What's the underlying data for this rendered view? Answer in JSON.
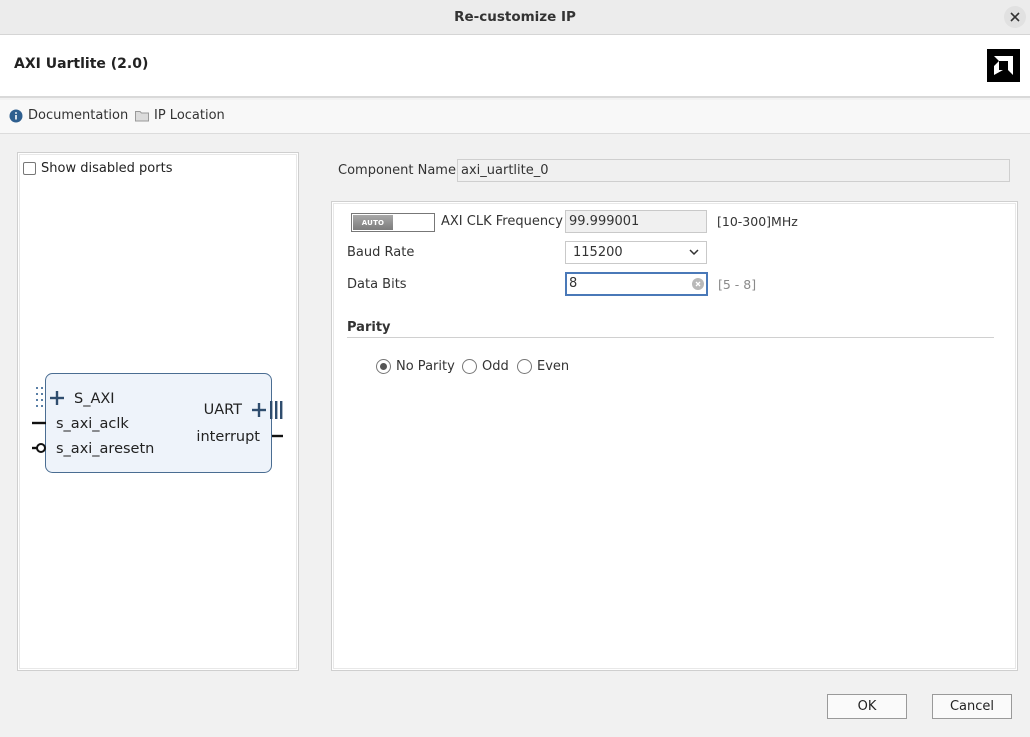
{
  "window": {
    "title": "Re-customize IP"
  },
  "header": {
    "ip_title": "AXI Uartlite (2.0)"
  },
  "links": [
    {
      "label": "Documentation",
      "icon": "info-icon"
    },
    {
      "label": "IP Location",
      "icon": "folder-icon"
    }
  ],
  "left_panel": {
    "show_disabled_ports_label": "Show disabled ports",
    "show_disabled_ports_checked": false,
    "symbol": {
      "left_ports": [
        "S_AXI",
        "s_axi_aclk",
        "s_axi_aresetn"
      ],
      "right_ports": [
        "UART",
        "interrupt"
      ]
    }
  },
  "component": {
    "label": "Component Name",
    "value": "axi_uartlite_0"
  },
  "config": {
    "auto_label": "AUTO",
    "clk_label": "AXI CLK Frequency",
    "clk_value": "99.999001",
    "clk_range": "[10-300]MHz",
    "baud_label": "Baud Rate",
    "baud_value": "115200",
    "data_bits_label": "Data Bits",
    "data_bits_value": "8",
    "data_bits_range": "[5 - 8]",
    "parity_title": "Parity",
    "parity_options": [
      "No Parity",
      "Odd",
      "Even"
    ],
    "parity_selected": "No Parity"
  },
  "buttons": {
    "ok": "OK",
    "cancel": "Cancel"
  },
  "colors": {
    "accent": "#4a79b8",
    "port_blue": "#2f4d6e",
    "symbol_fill": "#eef3fa"
  }
}
